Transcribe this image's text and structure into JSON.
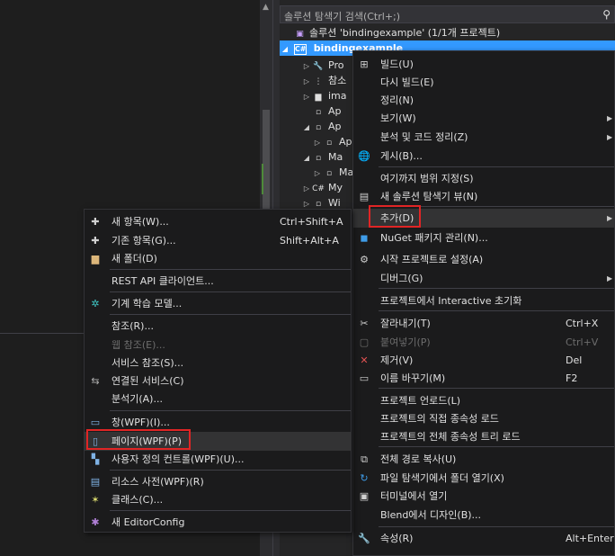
{
  "solution_explorer": {
    "search_label": "솔루션 탐색기 검색(Ctrl+;)",
    "solution_label": "솔루션 'bindingexample' (1/1개 프로젝트)",
    "project_label": "bindingexample",
    "project_icon": "C#",
    "nodes": [
      {
        "arrow": "▷",
        "icon": "wrench-icon",
        "glyph": "🔧",
        "label": "Pro"
      },
      {
        "arrow": "▷",
        "icon": "references-icon",
        "glyph": "⋮",
        "label": "참소"
      },
      {
        "arrow": "▷",
        "icon": "folder-icon",
        "glyph": "▆",
        "label": "ima"
      },
      {
        "arrow": "",
        "icon": "xaml-file-icon",
        "glyph": "▫",
        "label": "Ap"
      },
      {
        "arrow": "◢",
        "icon": "xaml-file-icon",
        "glyph": "▫",
        "label": "Ap"
      },
      {
        "arrow": "▷",
        "icon": "cs-file-icon",
        "glyph": "▫",
        "label": "Ap"
      },
      {
        "arrow": "◢",
        "icon": "xaml-file-icon",
        "glyph": "▫",
        "label": "Ma"
      },
      {
        "arrow": "▷",
        "icon": "cs-file-icon",
        "glyph": "▫",
        "label": "Ma"
      },
      {
        "arrow": "▷",
        "icon": "cs-file-icon",
        "glyph": "C#",
        "label": "My"
      },
      {
        "arrow": "▷",
        "icon": "xaml-file-icon",
        "glyph": "▫",
        "label": "Wi"
      }
    ]
  },
  "context_menu": {
    "items": [
      {
        "name": "build",
        "label": "빌드(U)",
        "icon": "build-icon",
        "glyph": "⊞",
        "key": "",
        "sub": false,
        "disabled": false
      },
      {
        "name": "rebuild",
        "label": "다시 빌드(E)",
        "icon": "",
        "glyph": "",
        "key": "",
        "sub": false,
        "disabled": false
      },
      {
        "name": "clean",
        "label": "정리(N)",
        "icon": "",
        "glyph": "",
        "key": "",
        "sub": false,
        "disabled": false
      },
      {
        "name": "view",
        "label": "보기(W)",
        "icon": "",
        "glyph": "",
        "key": "",
        "sub": true,
        "disabled": false
      },
      {
        "name": "analyze",
        "label": "분석 및 코드 정리(Z)",
        "icon": "",
        "glyph": "",
        "key": "",
        "sub": true,
        "disabled": false
      },
      {
        "name": "publish",
        "label": "게시(B)...",
        "icon": "globe-icon",
        "glyph": "🌐",
        "key": "",
        "sub": false,
        "disabled": false
      },
      {
        "name": "scope",
        "label": "여기까지 범위 지정(S)",
        "icon": "",
        "glyph": "",
        "key": "",
        "sub": false,
        "disabled": false
      },
      {
        "name": "new-view",
        "label": "새 솔루션 탐색기 뷰(N)",
        "icon": "new-view-icon",
        "glyph": "▤",
        "key": "",
        "sub": false,
        "disabled": false
      },
      {
        "name": "add",
        "label": "추가(D)",
        "icon": "",
        "glyph": "",
        "key": "",
        "sub": true,
        "disabled": false
      },
      {
        "name": "nuget",
        "label": "NuGet 패키지 관리(N)...",
        "icon": "nuget-icon",
        "glyph": "◼",
        "key": "",
        "sub": false,
        "disabled": false
      },
      {
        "name": "startup",
        "label": "시작 프로젝트로 설정(A)",
        "icon": "gear-icon",
        "glyph": "⚙",
        "key": "",
        "sub": false,
        "disabled": false
      },
      {
        "name": "debug",
        "label": "디버그(G)",
        "icon": "",
        "glyph": "",
        "key": "",
        "sub": true,
        "disabled": false
      },
      {
        "name": "interactive",
        "label": "프로젝트에서 Interactive 초기화",
        "icon": "",
        "glyph": "",
        "key": "",
        "sub": false,
        "disabled": false
      },
      {
        "name": "cut",
        "label": "잘라내기(T)",
        "icon": "scissors-icon",
        "glyph": "✂",
        "key": "Ctrl+X",
        "sub": false,
        "disabled": false
      },
      {
        "name": "paste",
        "label": "붙여넣기(P)",
        "icon": "paste-icon",
        "glyph": "▢",
        "key": "Ctrl+V",
        "sub": false,
        "disabled": true
      },
      {
        "name": "remove",
        "label": "제거(V)",
        "icon": "remove-icon",
        "glyph": "✕",
        "key": "Del",
        "sub": false,
        "disabled": false
      },
      {
        "name": "rename",
        "label": "이름 바꾸기(M)",
        "icon": "rename-icon",
        "glyph": "▭",
        "key": "F2",
        "sub": false,
        "disabled": false
      },
      {
        "name": "unload",
        "label": "프로젝트 언로드(L)",
        "icon": "",
        "glyph": "",
        "key": "",
        "sub": false,
        "disabled": false
      },
      {
        "name": "load-direct",
        "label": "프로젝트의 직접 종속성 로드",
        "icon": "",
        "glyph": "",
        "key": "",
        "sub": false,
        "disabled": false
      },
      {
        "name": "load-tree",
        "label": "프로젝트의 전체 종속성 트리 로드",
        "icon": "",
        "glyph": "",
        "key": "",
        "sub": false,
        "disabled": false
      },
      {
        "name": "copy-path",
        "label": "전체 경로 복사(U)",
        "icon": "copy-icon",
        "glyph": "⧉",
        "key": "",
        "sub": false,
        "disabled": false
      },
      {
        "name": "open-folder",
        "label": "파일 탐색기에서 폴더 열기(X)",
        "icon": "open-folder-icon",
        "glyph": "↻",
        "key": "",
        "sub": false,
        "disabled": false
      },
      {
        "name": "terminal",
        "label": "터미널에서 열기",
        "icon": "terminal-icon",
        "glyph": "▣",
        "key": "",
        "sub": false,
        "disabled": false
      },
      {
        "name": "blend",
        "label": "Blend에서 디자인(B)...",
        "icon": "",
        "glyph": "",
        "key": "",
        "sub": false,
        "disabled": false
      },
      {
        "name": "properties",
        "label": "속성(R)",
        "icon": "wrench-icon",
        "glyph": "🔧",
        "key": "Alt+Enter",
        "sub": false,
        "disabled": false
      }
    ]
  },
  "add_submenu": {
    "items": [
      {
        "name": "new-item",
        "label": "새 항목(W)...",
        "icon": "new-item-icon",
        "glyph": "✚",
        "key": "Ctrl+Shift+A",
        "disabled": false
      },
      {
        "name": "existing-item",
        "label": "기존 항목(G)...",
        "icon": "existing-item-icon",
        "glyph": "✚",
        "key": "Shift+Alt+A",
        "disabled": false
      },
      {
        "name": "new-folder",
        "label": "새 폴더(D)",
        "icon": "new-folder-icon",
        "glyph": "▆",
        "key": "",
        "disabled": false
      },
      {
        "name": "rest-api",
        "label": "REST API 클라이언트...",
        "icon": "",
        "glyph": "",
        "key": "",
        "disabled": false
      },
      {
        "name": "ml-model",
        "label": "기계 학습 모델...",
        "icon": "ml-icon",
        "glyph": "✲",
        "key": "",
        "disabled": false
      },
      {
        "name": "reference",
        "label": "참조(R)...",
        "icon": "",
        "glyph": "",
        "key": "",
        "disabled": false
      },
      {
        "name": "web-reference",
        "label": "웹 참조(E)...",
        "icon": "",
        "glyph": "",
        "key": "",
        "disabled": true
      },
      {
        "name": "service-reference",
        "label": "서비스 참조(S)...",
        "icon": "",
        "glyph": "",
        "key": "",
        "disabled": false
      },
      {
        "name": "connected-service",
        "label": "연결된 서비스(C)",
        "icon": "connected-service-icon",
        "glyph": "⇆",
        "key": "",
        "disabled": false
      },
      {
        "name": "analyzer",
        "label": "분석기(A)...",
        "icon": "",
        "glyph": "",
        "key": "",
        "disabled": false
      },
      {
        "name": "window-wpf",
        "label": "창(WPF)(I)...",
        "icon": "window-icon",
        "glyph": "▭",
        "key": "",
        "disabled": false
      },
      {
        "name": "page-wpf",
        "label": "페이지(WPF)(P)",
        "icon": "page-icon",
        "glyph": "▯",
        "key": "",
        "disabled": false
      },
      {
        "name": "user-control-wpf",
        "label": "사용자 정의 컨트롤(WPF)(U)...",
        "icon": "user-control-icon",
        "glyph": "▚",
        "key": "",
        "disabled": false
      },
      {
        "name": "resource-dictionary",
        "label": "리소스 사전(WPF)(R)",
        "icon": "resource-dictionary-icon",
        "glyph": "▤",
        "key": "",
        "disabled": false
      },
      {
        "name": "class",
        "label": "클래스(C)...",
        "icon": "class-icon",
        "glyph": "✶",
        "key": "",
        "disabled": false
      },
      {
        "name": "editorconfig",
        "label": "새 EditorConfig",
        "icon": "editorconfig-icon",
        "glyph": "✱",
        "key": "",
        "disabled": false
      }
    ]
  },
  "colors": {
    "selection": "#3399ff",
    "highlight_box": "#e02525",
    "menu_bg": "#1b1b1c",
    "panel_bg": "#252526"
  }
}
